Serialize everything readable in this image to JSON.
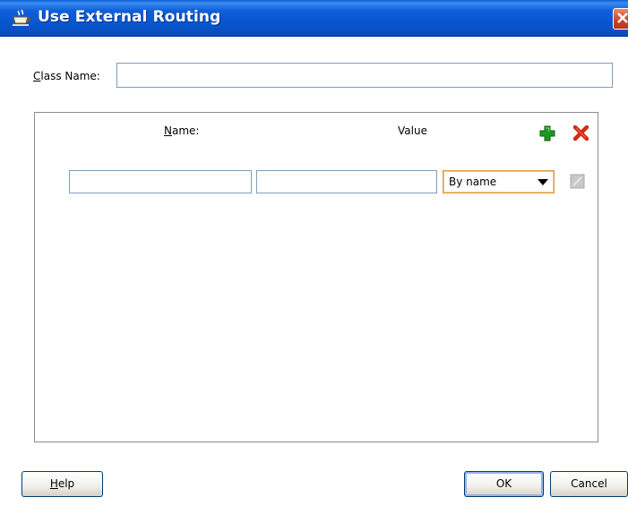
{
  "window": {
    "title": "Use External Routing",
    "title_icon": "coffee-cup-icon",
    "close_icon": "close-icon"
  },
  "class_name": {
    "label_mnemonic": "C",
    "label_rest": "lass Name:",
    "value": ""
  },
  "table": {
    "header_name_mnemonic": "N",
    "header_name_rest": "ame:",
    "header_value": "Value",
    "add_icon": "plus-icon",
    "delete_icon": "delete-icon",
    "row": {
      "name_value": "",
      "value_value": "",
      "mode_selected": "By name",
      "edit_icon": "edit-icon"
    }
  },
  "buttons": {
    "help_mnemonic": "H",
    "help_rest": "elp",
    "ok": "OK",
    "cancel": "Cancel"
  },
  "colors": {
    "titlebar": "#0754cc",
    "add": "#1e9b1e",
    "delete": "#d42a10"
  }
}
